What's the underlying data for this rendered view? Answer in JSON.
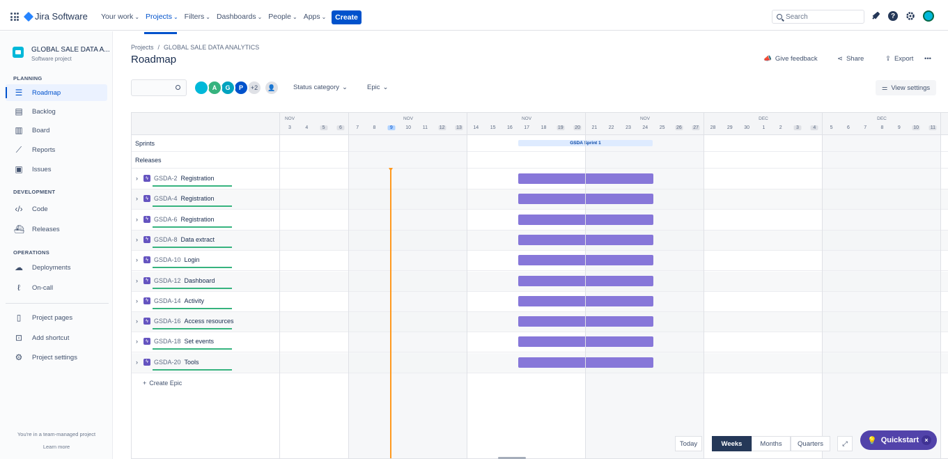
{
  "app": {
    "name": "Jira Software"
  },
  "nav": {
    "items": [
      {
        "label": "Your work",
        "dropdown": true,
        "active": false
      },
      {
        "label": "Projects",
        "dropdown": true,
        "active": true
      },
      {
        "label": "Filters",
        "dropdown": true,
        "active": false
      },
      {
        "label": "Dashboards",
        "dropdown": true,
        "active": false
      },
      {
        "label": "People",
        "dropdown": true,
        "active": false
      },
      {
        "label": "Apps",
        "dropdown": true,
        "active": false
      }
    ],
    "create_label": "Create",
    "search_placeholder": "Search"
  },
  "sidebar": {
    "project_name": "GLOBAL SALE DATA A...",
    "project_type": "Software project",
    "sections": {
      "planning": "PLANNING",
      "development": "DEVELOPMENT",
      "operations": "OPERATIONS"
    },
    "items": {
      "roadmap": "Roadmap",
      "backlog": "Backlog",
      "board": "Board",
      "reports": "Reports",
      "issues": "Issues",
      "code": "Code",
      "releases": "Releases",
      "deployments": "Deployments",
      "oncall": "On-call",
      "project_pages": "Project pages",
      "add_shortcut": "Add shortcut",
      "project_settings": "Project settings"
    },
    "team_managed": "You're in a team-managed project",
    "learn_more": "Learn more"
  },
  "breadcrumb": {
    "projects": "Projects",
    "separator": "/",
    "project": "GLOBAL SALE DATA ANALYTICS"
  },
  "page_title": "Roadmap",
  "actions": {
    "feedback": "Give feedback",
    "share": "Share",
    "export": "Export",
    "more": "•••"
  },
  "filters": {
    "avatars": [
      {
        "initial": "",
        "color": "#00b8d9"
      },
      {
        "initial": "A",
        "color": "#36b37e"
      },
      {
        "initial": "G",
        "color": "#00a3bf"
      },
      {
        "initial": "P",
        "color": "#0052cc"
      }
    ],
    "more_count": "+2",
    "status_category": "Status category",
    "epic": "Epic",
    "view_settings": "View settings"
  },
  "timeline": {
    "months": [
      "NOV",
      "NOV",
      "NOV",
      "NOV",
      "DEC",
      "DEC"
    ],
    "days": [
      "3",
      "4",
      "5",
      "6",
      "7",
      "8",
      "9",
      "10",
      "11",
      "12",
      "13",
      "14",
      "15",
      "16",
      "17",
      "18",
      "19",
      "20",
      "21",
      "22",
      "23",
      "24",
      "25",
      "26",
      "27",
      "28",
      "29",
      "30",
      "1",
      "2",
      "3",
      "4",
      "5",
      "6",
      "7",
      "8",
      "9",
      "10",
      "11"
    ],
    "weekend_days_index": [
      2,
      3,
      9,
      10,
      16,
      17,
      23,
      24,
      30,
      31,
      37,
      38
    ],
    "today_index": 6
  },
  "rows": {
    "sprints": "Sprints",
    "releases": "Releases",
    "sprint_name": "GSDA Sprint 1"
  },
  "epics": [
    {
      "key": "GSDA-2",
      "name": "Registration"
    },
    {
      "key": "GSDA-4",
      "name": "Registration"
    },
    {
      "key": "GSDA-6",
      "name": "Registration"
    },
    {
      "key": "GSDA-8",
      "name": "Data extract"
    },
    {
      "key": "GSDA-10",
      "name": "Login"
    },
    {
      "key": "GSDA-12",
      "name": "Dashboard"
    },
    {
      "key": "GSDA-14",
      "name": "Activity"
    },
    {
      "key": "GSDA-16",
      "name": "Access resources"
    },
    {
      "key": "GSDA-18",
      "name": "Set events"
    },
    {
      "key": "GSDA-20",
      "name": "Tools"
    }
  ],
  "create_epic": "Create Epic",
  "zoom": {
    "today": "Today",
    "weeks": "Weeks",
    "months": "Months",
    "quarters": "Quarters",
    "selected": "Weeks"
  },
  "quickstart": {
    "label": "Quickstart",
    "close": "×"
  }
}
